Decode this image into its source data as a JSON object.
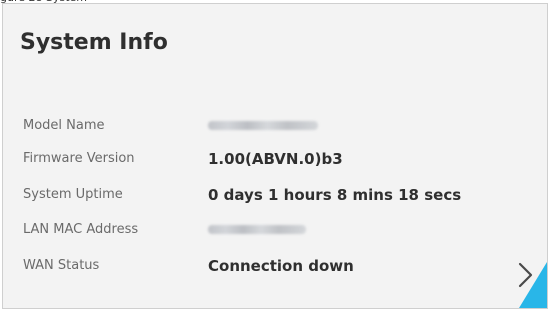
{
  "panel": {
    "title": "System Info"
  },
  "system_info": {
    "rows": [
      {
        "label": "Model Name",
        "value": ""
      },
      {
        "label": "Firmware Version",
        "value": "1.00(ABVN.0)b3"
      },
      {
        "label": "System Uptime",
        "value": "0 days 1 hours 8 mins 18 secs"
      },
      {
        "label": "LAN MAC Address",
        "value": ""
      },
      {
        "label": "WAN Status",
        "value": "Connection down"
      }
    ]
  },
  "colors": {
    "panel_background": "#f3f3f3",
    "accent": "#29b6e8",
    "title_text": "#2f2f2f",
    "label_text": "#6a6a6a"
  },
  "icons": {
    "more": "chevron-right-icon"
  }
}
